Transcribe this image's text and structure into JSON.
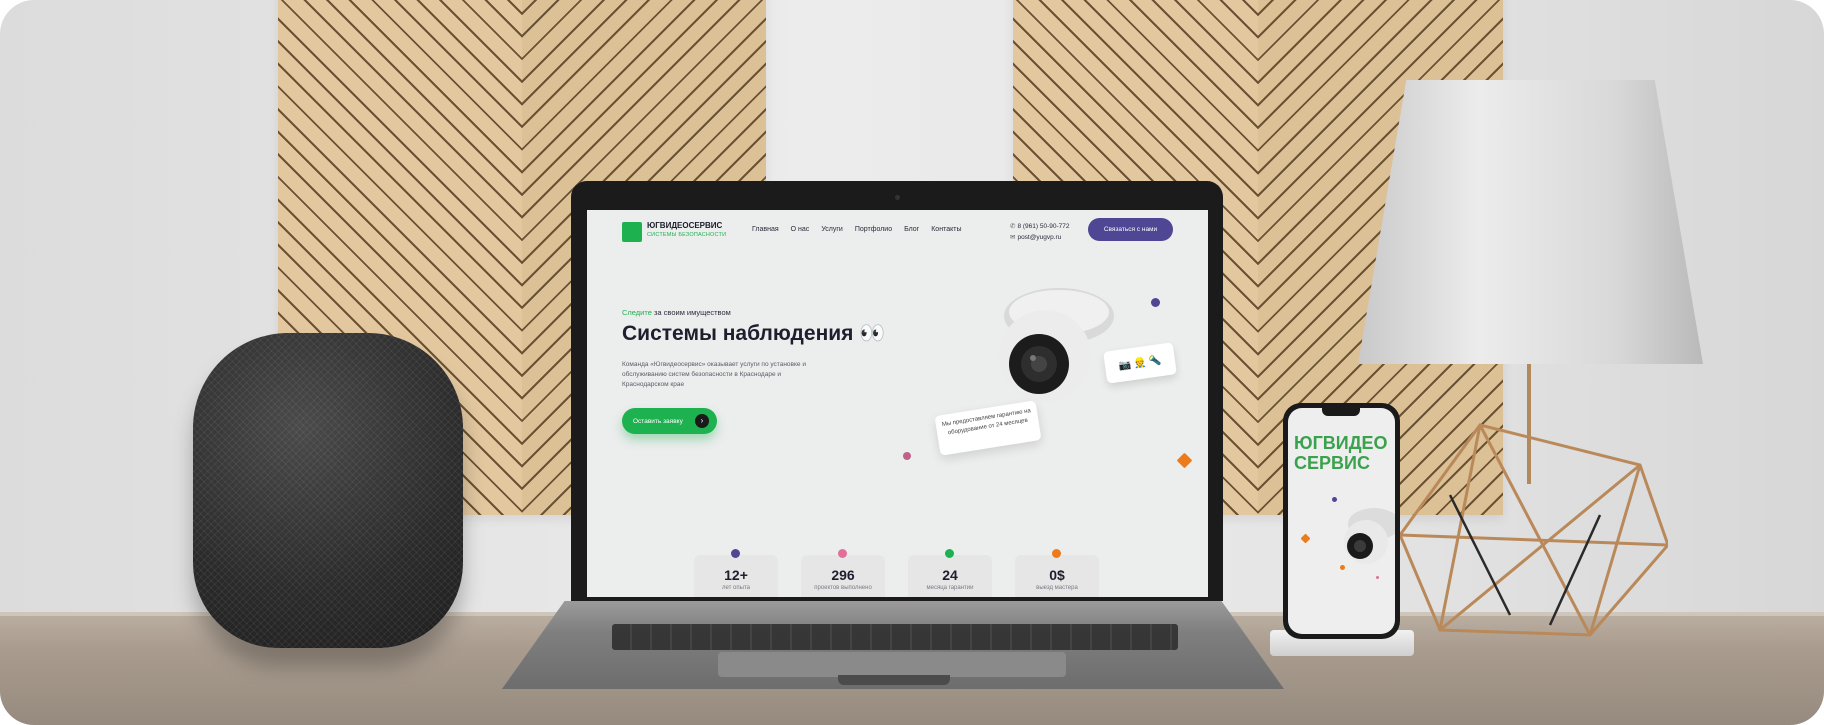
{
  "brand": {
    "name": "ЮГВИДЕОСЕРВИС",
    "subtitle": "СИСТЕМЫ БЕЗОПАСНОСТИ",
    "accent_green": "#1eb14f",
    "accent_purple": "#4f4694"
  },
  "nav": {
    "items": [
      "Главная",
      "О нас",
      "Услуги",
      "Портфолио",
      "Блог",
      "Контакты"
    ]
  },
  "contact": {
    "phone": "8 (961) 50-90-772",
    "email": "post@yugvp.ru",
    "cta": "Связаться с нами"
  },
  "hero": {
    "eyebrow_highlight": "Следите",
    "eyebrow_rest": "за своим имуществом",
    "title": "Системы наблюдения 👀",
    "description": "Команда «Югвидеосервис» оказывает услуги по установке и обслуживанию систем безопасности в Краснодаре и Краснодарском крае",
    "button": "Оставить заявку",
    "warranty_card": "Мы предоставляем гарантию на оборудование от 24 месяцев",
    "badge_icons": "📷 👷 🔦"
  },
  "stats": [
    {
      "value": "12+",
      "label": "лет опыта",
      "color": "#4f4694"
    },
    {
      "value": "296",
      "label": "проектов выполнено",
      "color": "#e26f9a"
    },
    {
      "value": "24",
      "label": "месяца гарантии",
      "color": "#1eb14f"
    },
    {
      "value": "0$",
      "label": "выезд мастера",
      "color": "#ee7a1a"
    }
  ],
  "phone": {
    "title_line1": "ЮГВИДЕО",
    "title_line2": "СЕРВИС"
  }
}
